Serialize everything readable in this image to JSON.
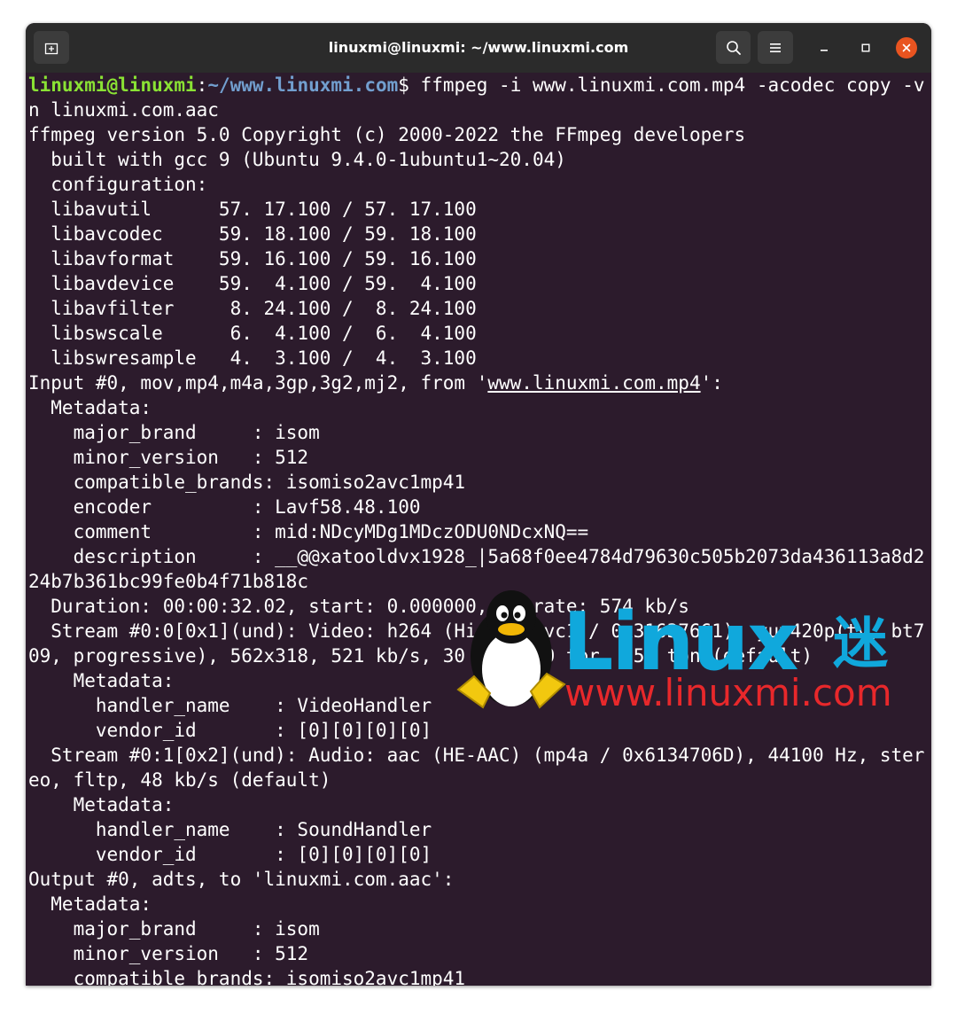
{
  "window": {
    "title": "linuxmi@linuxmi: ~/www.linuxmi.com",
    "icons": {
      "new_tab": "new-tab-icon",
      "search": "search-icon",
      "menu": "hamburger-menu-icon",
      "minimize": "minimize-icon",
      "maximize": "maximize-icon",
      "close": "close-icon"
    }
  },
  "terminal": {
    "prompt": {
      "user": "linuxmi@linuxmi",
      "colon": ":",
      "path": "~/www.linuxmi.com",
      "dollar": "$",
      "command": " ffmpeg -i www.linuxmi.com.mp4 -acodec copy -v"
    },
    "input_line": {
      "prefix": "Input #0, mov,mp4,m4a,3gp,3g2,mj2, from '",
      "file": "www.linuxmi.com.mp4",
      "suffix": "':"
    },
    "lines": [
      "n linuxmi.com.aac",
      "ffmpeg version 5.0 Copyright (c) 2000-2022 the FFmpeg developers",
      "  built with gcc 9 (Ubuntu 9.4.0-1ubuntu1~20.04)",
      "  configuration:",
      "  libavutil      57. 17.100 / 57. 17.100",
      "  libavcodec     59. 18.100 / 59. 18.100",
      "  libavformat    59. 16.100 / 59. 16.100",
      "  libavdevice    59.  4.100 / 59.  4.100",
      "  libavfilter     8. 24.100 /  8. 24.100",
      "  libswscale      6.  4.100 /  6.  4.100",
      "  libswresample   4.  3.100 /  4.  3.100",
      "  Metadata:",
      "    major_brand     : isom",
      "    minor_version   : 512",
      "    compatible_brands: isomiso2avc1mp41",
      "    encoder         : Lavf58.48.100",
      "    comment         : mid:NDcyMDg1MDczODU0NDcxNQ==",
      "    description     : __@@xatooldvx1928_|5a68f0ee4784d79630c505b2073da436113a8d2",
      "24b7b361bc99fe0b4f71b818c",
      "  Duration: 00:00:32.02, start: 0.000000, bitrate: 574 kb/s",
      "  Stream #0:0[0x1](und): Video: h264 (High) (avc1 / 0x31637661), yuv420p(tv, bt7",
      "09, progressive), 562x318, 521 kb/s, 30 fps, 30 tbr, 15k tbn (default)",
      "    Metadata:",
      "      handler_name    : VideoHandler",
      "      vendor_id       : [0][0][0][0]",
      "  Stream #0:1[0x2](und): Audio: aac (HE-AAC) (mp4a / 0x6134706D), 44100 Hz, ster",
      "eo, fltp, 48 kb/s (default)",
      "    Metadata:",
      "      handler_name    : SoundHandler",
      "      vendor_id       : [0][0][0][0]",
      "Output #0, adts, to 'linuxmi.com.aac':",
      "  Metadata:",
      "    major_brand     : isom",
      "    minor_version   : 512",
      "    compatible_brands: isomiso2avc1mp41"
    ]
  },
  "watermark": {
    "brand": "Linux",
    "brand_cjk": "迷",
    "url": "www.linuxmi.com",
    "colors": {
      "brand": "#10a8dc",
      "url": "#e8282b"
    }
  },
  "colors": {
    "terminal_bg": "#2c1b2c",
    "titlebar_bg": "#2b2b2b",
    "prompt_user": "#8ae234",
    "prompt_path": "#729fcf",
    "close_button": "#e95420"
  }
}
